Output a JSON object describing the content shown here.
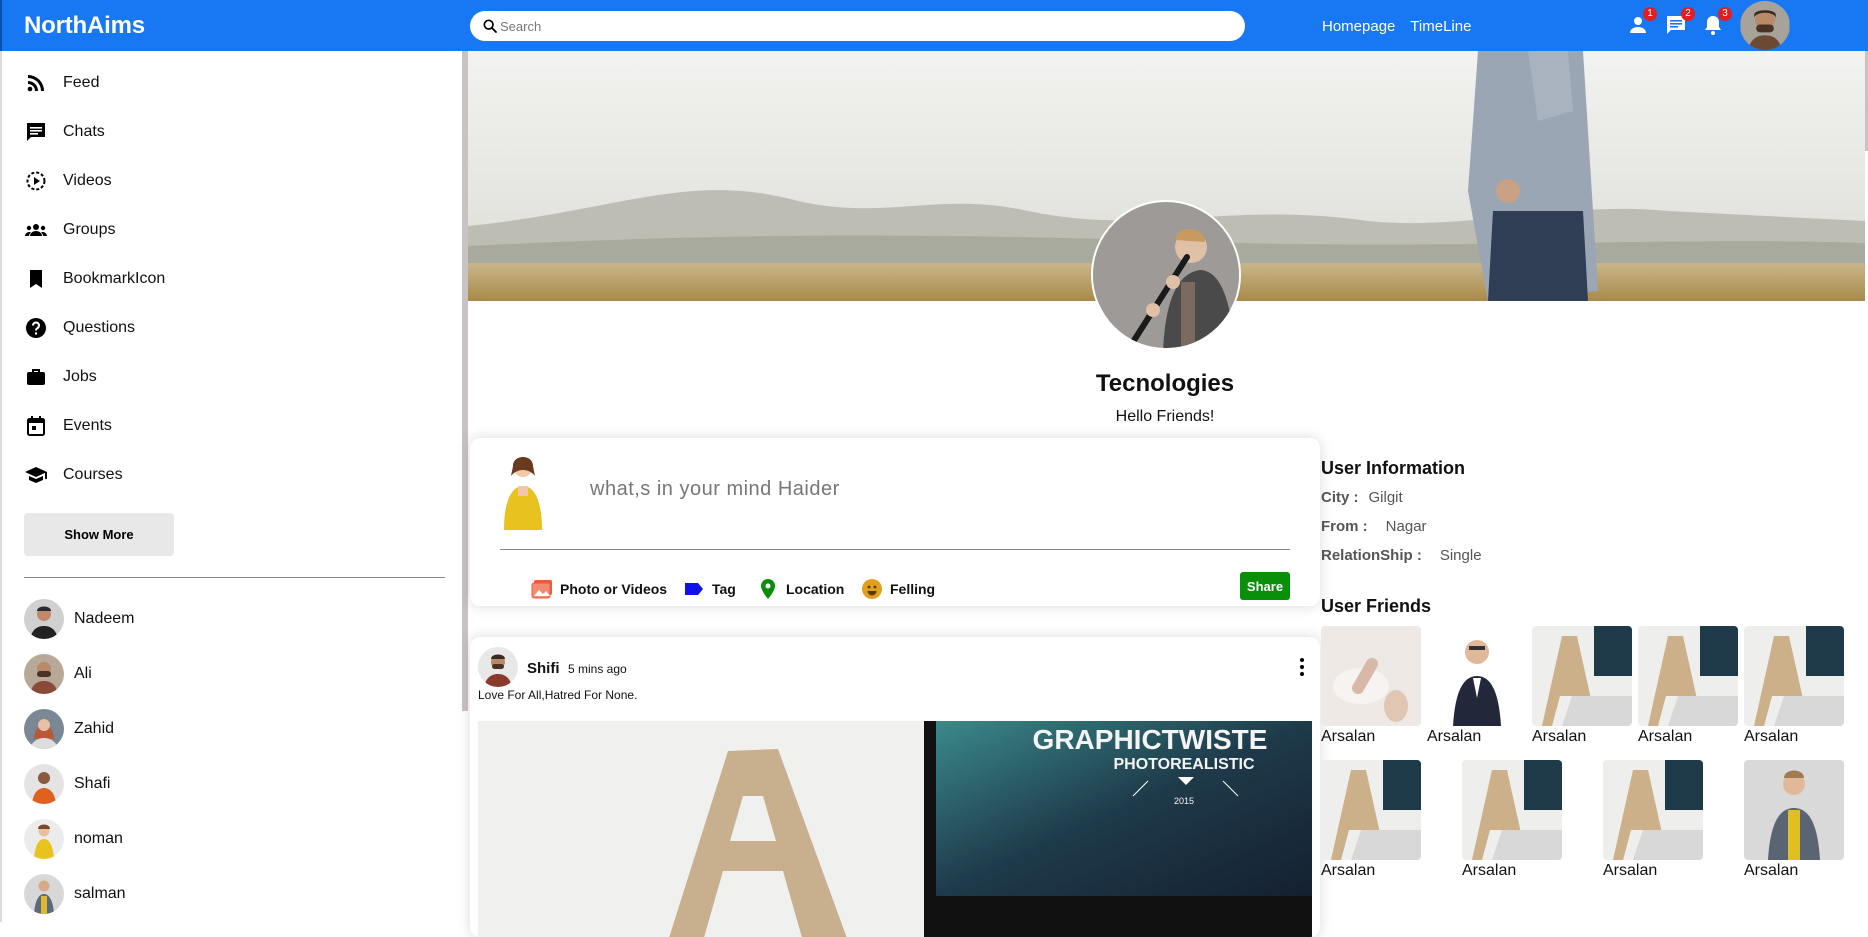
{
  "header": {
    "brand": "NorthAims",
    "search_placeholder": "Search",
    "links": [
      "Homepage",
      "TimeLine"
    ],
    "badges": {
      "friends": "1",
      "messages": "2",
      "notifications": "3"
    }
  },
  "sidebar": {
    "items": [
      {
        "label": "Feed",
        "icon": "rss-icon"
      },
      {
        "label": "Chats",
        "icon": "chat-icon"
      },
      {
        "label": "Videos",
        "icon": "play-circle-icon"
      },
      {
        "label": "Groups",
        "icon": "groups-icon"
      },
      {
        "label": "BookmarkIcon",
        "icon": "bookmark-icon"
      },
      {
        "label": "Questions",
        "icon": "help-icon"
      },
      {
        "label": "Jobs",
        "icon": "briefcase-icon"
      },
      {
        "label": "Events",
        "icon": "calendar-icon"
      },
      {
        "label": "Courses",
        "icon": "school-icon"
      }
    ],
    "show_more": "Show More",
    "friends": [
      "Nadeem",
      "Ali",
      "Zahid",
      "Shafi",
      "noman",
      "salman"
    ]
  },
  "profile": {
    "name": "Tecnologies",
    "description": "Hello Friends!"
  },
  "share": {
    "prompt": "what,s in your mind Haider",
    "options": [
      "Photo or Videos",
      "Tag",
      "Location",
      "Felling"
    ],
    "share_label": "Share"
  },
  "post": {
    "author": "Shifi",
    "time": "5 mins ago",
    "text": "Love For All,Hatred For None.",
    "image_text_1": "GRAPHICTWISTE",
    "image_text_2": "PHOTOREALISTIC",
    "image_text_3": "2015"
  },
  "user_info": {
    "title": "User Information",
    "rows": [
      {
        "key": "City :",
        "value": "Gilgit"
      },
      {
        "key": "From :",
        "value": "Nagar"
      },
      {
        "key": "RelationShip :",
        "value": "Single"
      }
    ]
  },
  "user_friends": {
    "title": "User Friends",
    "names": [
      "Arsalan",
      "Arsalan",
      "Arsalan",
      "Arsalan",
      "Arsalan",
      "Arsalan",
      "Arsalan",
      "Arsalan",
      "Arsalan"
    ]
  },
  "colors": {
    "brand_blue": "#1877f2",
    "share_green": "#0a8f0a",
    "badge_red": "#e41e1e"
  }
}
